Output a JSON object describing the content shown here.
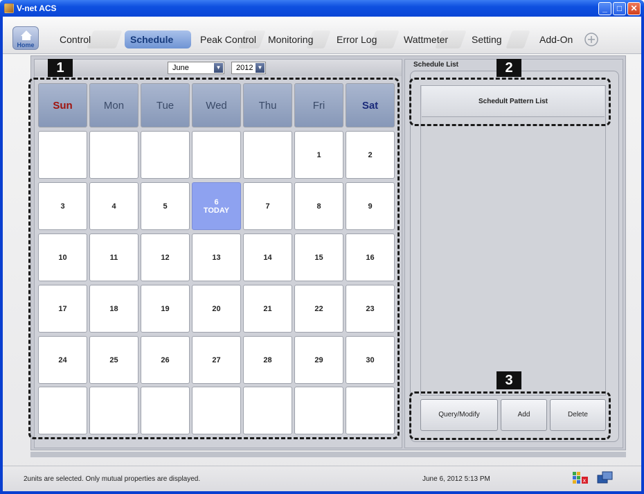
{
  "window": {
    "title": "V-net ACS",
    "buttons": {
      "minimize": "_",
      "maximize": "□",
      "close": "✕"
    }
  },
  "nav": {
    "home_label": "Home",
    "tabs": [
      {
        "label": "Control",
        "active": false
      },
      {
        "label": "Schedule",
        "active": true
      },
      {
        "label": "Peak Control",
        "active": false
      },
      {
        "label": "Monitoring",
        "active": false
      },
      {
        "label": "Error Log",
        "active": false
      },
      {
        "label": "Wattmeter",
        "active": false
      },
      {
        "label": "Setting",
        "active": false
      },
      {
        "label": "Add-On",
        "active": false
      }
    ]
  },
  "calendar": {
    "month": "June",
    "year": "2012",
    "weekdays": [
      "Sun",
      "Mon",
      "Tue",
      "Wed",
      "Thu",
      "Fri",
      "Sat"
    ],
    "days": [
      "",
      "",
      "",
      "",
      "",
      "1",
      "2",
      "3",
      "4",
      "5",
      "6",
      "7",
      "8",
      "9",
      "10",
      "11",
      "12",
      "13",
      "14",
      "15",
      "16",
      "17",
      "18",
      "19",
      "20",
      "21",
      "22",
      "23",
      "24",
      "25",
      "26",
      "27",
      "28",
      "29",
      "30",
      "",
      "",
      "",
      "",
      "",
      "",
      ""
    ],
    "today_label": "TODAY",
    "today": "6"
  },
  "annotations": [
    "1",
    "2",
    "3"
  ],
  "schedule": {
    "title": "Schedule List",
    "list_header": "Schedult Pattern List",
    "buttons": {
      "query_modify": "Query/Modify",
      "add": "Add",
      "delete": "Delete"
    }
  },
  "status": {
    "message": "2units are selected. Only mutual properties are displayed.",
    "datetime": "June 6, 2012  5:13 PM"
  },
  "colors": {
    "titlebar": "#0e50e0",
    "today": "#8ea2f0",
    "sunday": "#a0140e",
    "active_tab": "#6f94d4"
  }
}
